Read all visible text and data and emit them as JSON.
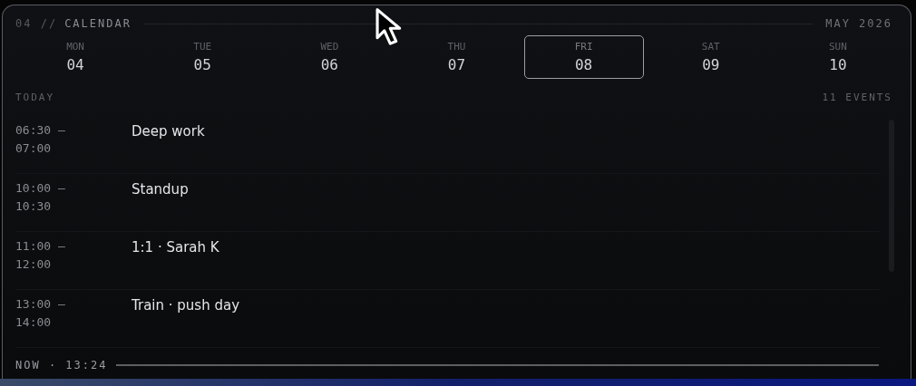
{
  "header": {
    "index": "04 //",
    "title": "CALENDAR",
    "month": "MAY 2026"
  },
  "days": [
    {
      "name": "MON",
      "date": "04",
      "selected": false
    },
    {
      "name": "TUE",
      "date": "05",
      "selected": false
    },
    {
      "name": "WED",
      "date": "06",
      "selected": false
    },
    {
      "name": "THU",
      "date": "07",
      "selected": false
    },
    {
      "name": "FRI",
      "date": "08",
      "selected": true
    },
    {
      "name": "SAT",
      "date": "09",
      "selected": false
    },
    {
      "name": "SUN",
      "date": "10",
      "selected": false
    }
  ],
  "agenda": {
    "label": "TODAY",
    "count": "11 EVENTS"
  },
  "events": [
    {
      "start": "06:30 –",
      "end": "07:00",
      "title": "Deep work"
    },
    {
      "start": "10:00 –",
      "end": "10:30",
      "title": "Standup"
    },
    {
      "start": "11:00 –",
      "end": "12:00",
      "title": "1:1 · Sarah K"
    },
    {
      "start": "13:00 –",
      "end": "14:00",
      "title": "Train · push day"
    }
  ],
  "now": "NOW · 13:24"
}
